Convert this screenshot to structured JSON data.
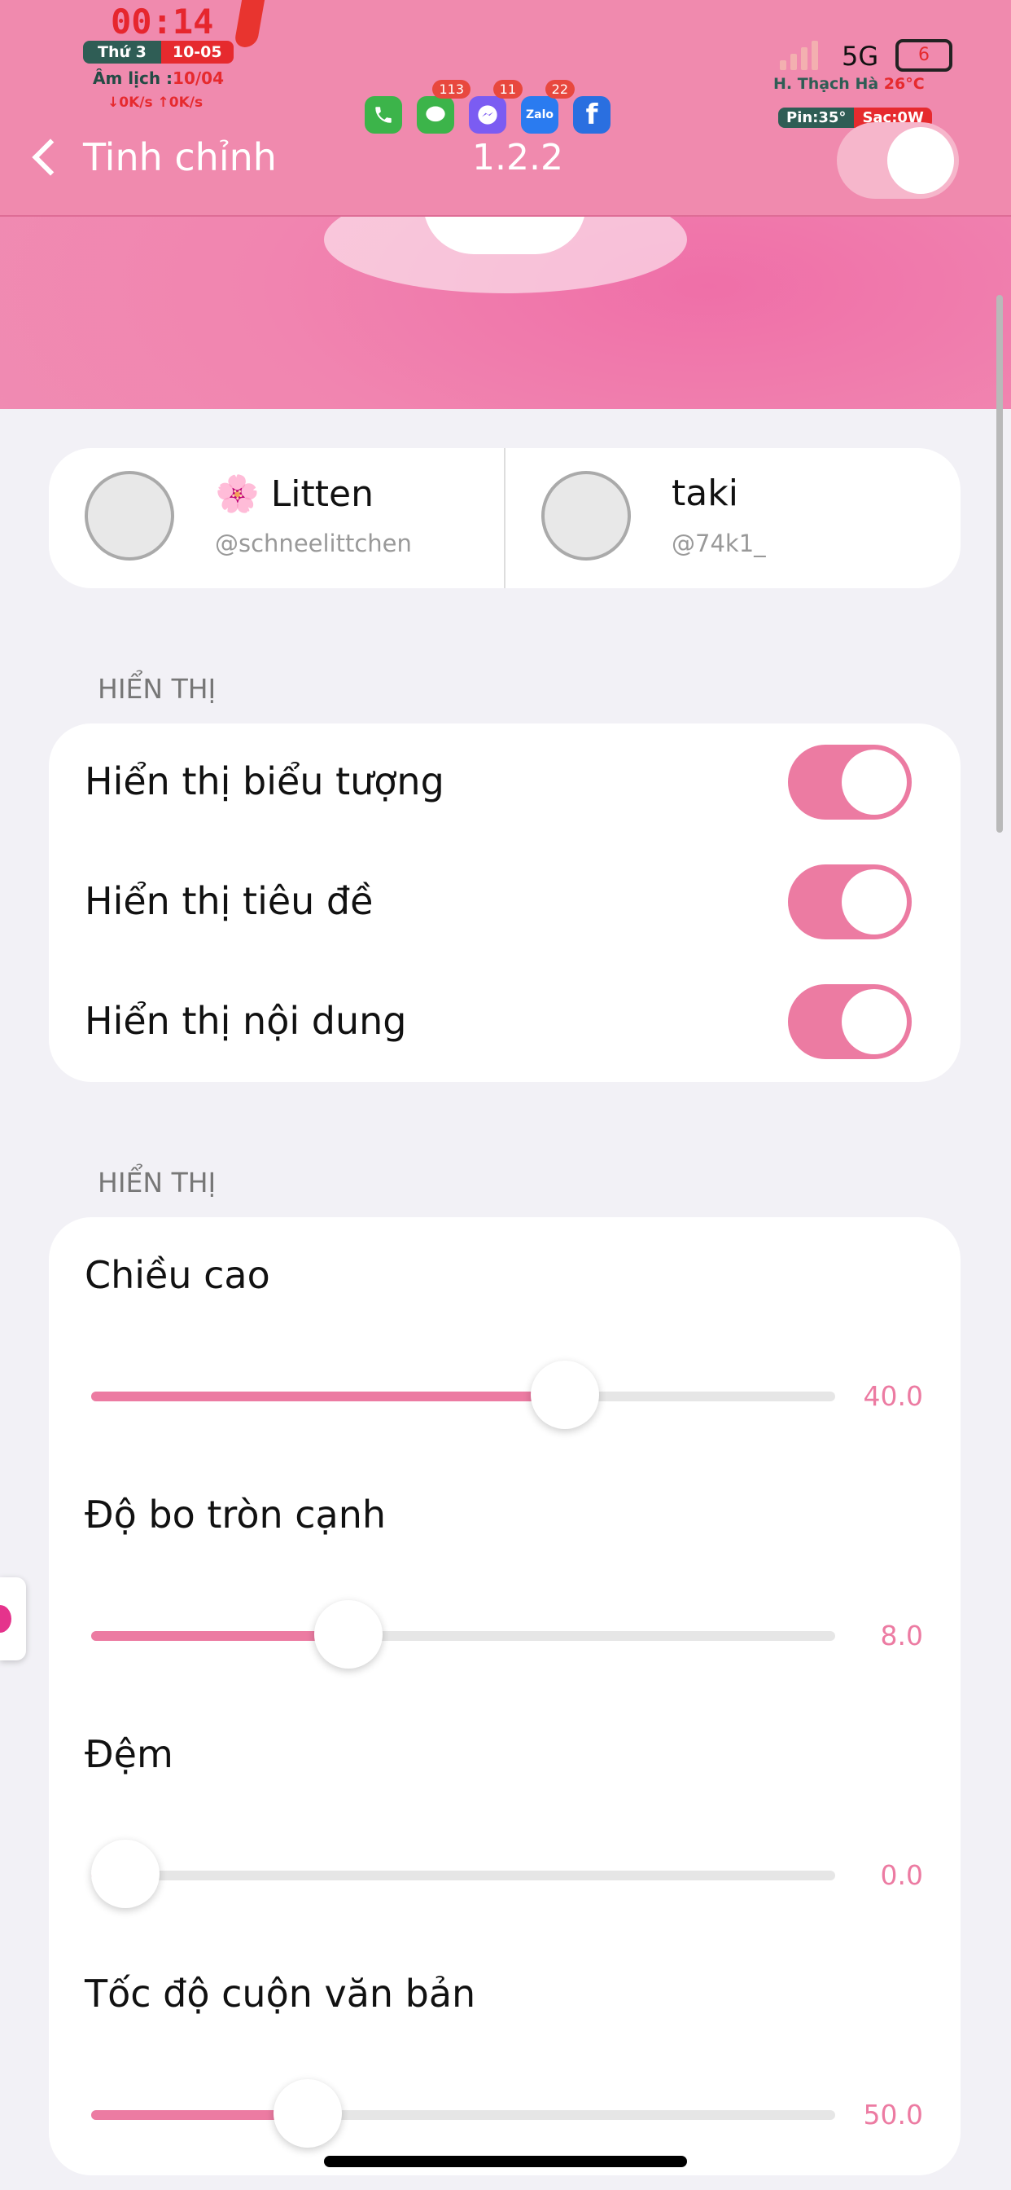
{
  "status": {
    "clock": "00:14",
    "day": "Thứ 3",
    "date": "10-05",
    "lunar_label": "Âm lịch :",
    "lunar_date": "10/04",
    "net_speed": "↓0K/s ↑0K/s",
    "network": "5G",
    "battery": "6",
    "weather_place": "H. Thạch Hà",
    "weather_temp": "26°C",
    "pin": "Pin:35°",
    "charge": "Sạc:0W",
    "apps": [
      {
        "name": "phone",
        "badge": ""
      },
      {
        "name": "messages",
        "badge": "113"
      },
      {
        "name": "messenger",
        "badge": "11"
      },
      {
        "name": "zalo",
        "badge": "22",
        "label": "Zalo"
      },
      {
        "name": "facebook",
        "badge": "",
        "label": "f"
      }
    ]
  },
  "nav": {
    "back_label": "Tinh chỉnh",
    "version": "1.2.2",
    "master_toggle": true
  },
  "credits": [
    {
      "name": "🌸 Litten",
      "handle": "@schneelittchen"
    },
    {
      "name": "taki",
      "handle": "@74k1_"
    }
  ],
  "display_section": {
    "header": "HIỂN THỊ",
    "rows": [
      {
        "label": "Hiển thị biểu tượng",
        "on": true
      },
      {
        "label": "Hiển thị tiêu đề",
        "on": true
      },
      {
        "label": "Hiển thị nội dung",
        "on": true
      }
    ]
  },
  "layout_section": {
    "header": "HIỂN THỊ",
    "sliders": [
      {
        "label": "Chiều cao",
        "value": "40.0",
        "fraction": 0.65
      },
      {
        "label": "Độ bo tròn cạnh",
        "value": "8.0",
        "fraction": 0.33
      },
      {
        "label": "Đệm",
        "value": "0.0",
        "fraction": 0.0
      },
      {
        "label": "Tốc độ cuộn văn bản",
        "value": "50.0",
        "fraction": 0.27
      }
    ]
  },
  "colors": {
    "accent": "#ec7ba2",
    "header": "#f08aae"
  }
}
